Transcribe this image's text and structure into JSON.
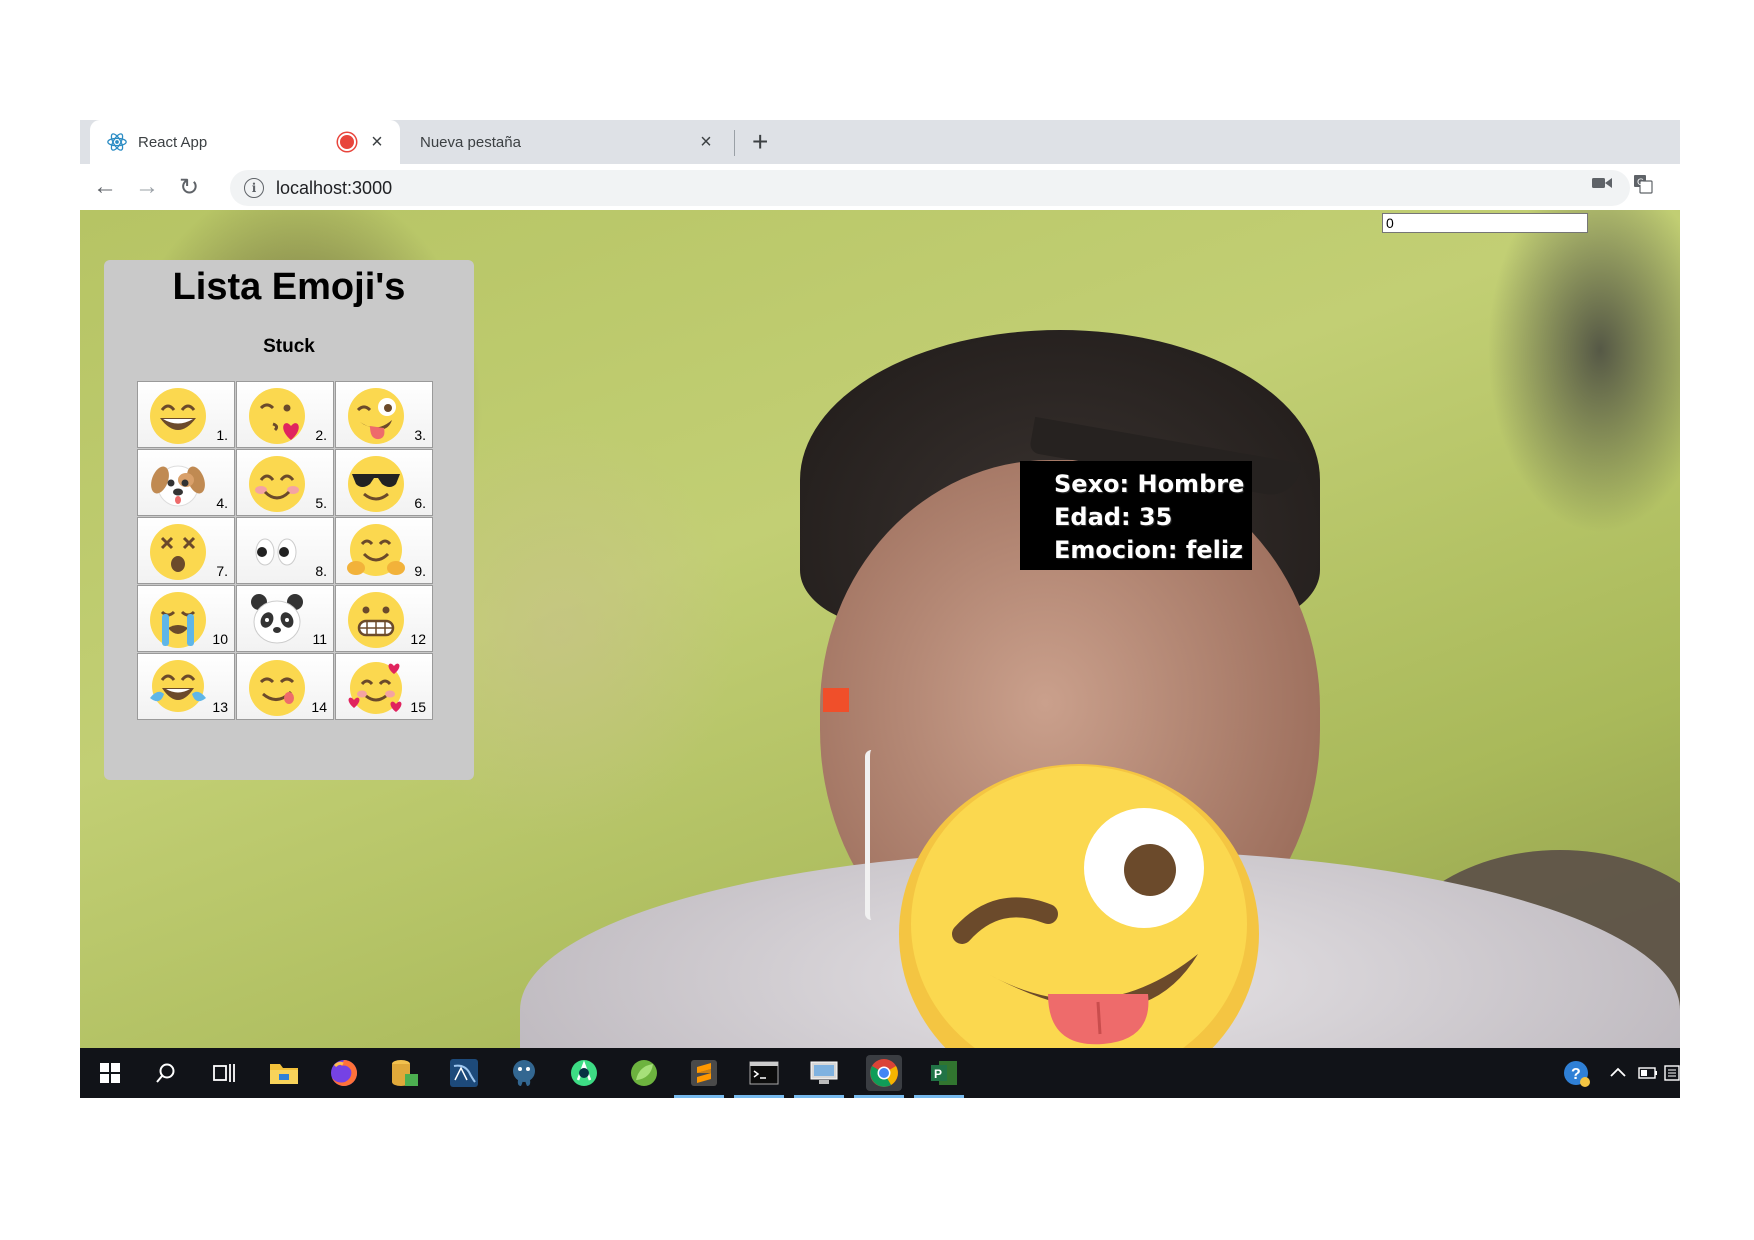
{
  "browser": {
    "tabs": [
      {
        "title": "React App",
        "favicon": "react-icon",
        "recording": true,
        "active": true
      },
      {
        "title": "Nueva pestaña",
        "active": false
      }
    ],
    "address": "localhost:3000",
    "tab_close_glyph": "×",
    "new_tab_glyph": "+"
  },
  "nav": {
    "back": "←",
    "forward": "→",
    "reload": "↻"
  },
  "panel": {
    "title": "Lista Emoji's",
    "subtitle": "Stuck",
    "emojis": [
      {
        "num": "1.",
        "icon": "grinning-face"
      },
      {
        "num": "2.",
        "icon": "face-blowing-kiss"
      },
      {
        "num": "3.",
        "icon": "winking-face-tongue"
      },
      {
        "num": "4.",
        "icon": "dog-face"
      },
      {
        "num": "5.",
        "icon": "smiling-face-blush"
      },
      {
        "num": "6.",
        "icon": "sunglasses-face"
      },
      {
        "num": "7.",
        "icon": "dizzy-face"
      },
      {
        "num": "8.",
        "icon": "eyes"
      },
      {
        "num": "9.",
        "icon": "hugging-face"
      },
      {
        "num": "10",
        "icon": "loudly-crying-face"
      },
      {
        "num": "11",
        "icon": "panda-face"
      },
      {
        "num": "12",
        "icon": "grimacing-face"
      },
      {
        "num": "13",
        "icon": "tears-of-joy"
      },
      {
        "num": "14",
        "icon": "face-savoring-food"
      },
      {
        "num": "15",
        "icon": "smiling-face-hearts"
      }
    ]
  },
  "detection": {
    "sexo": "Sexo: Hombre",
    "edad": "Edad: 35",
    "emocion": "Emocion: feliz",
    "overlay_emoji": "winking-face-tongue",
    "counter_value": "0",
    "marker_color": "#f04f2a"
  },
  "taskbar": {
    "apps": [
      "windows-start-icon",
      "search-icon",
      "task-view-icon",
      "file-explorer-icon",
      "firefox-icon",
      "database-tool-icon",
      "mysql-workbench-icon",
      "postgresql-icon",
      "android-studio-icon",
      "spring-tool-icon",
      "sublime-text-icon",
      "terminal-icon",
      "remote-desktop-icon",
      "chrome-icon",
      "project-icon"
    ],
    "tray": [
      "help-icon",
      "chevron-up-icon",
      "battery-icon",
      "notifications-icon"
    ]
  }
}
